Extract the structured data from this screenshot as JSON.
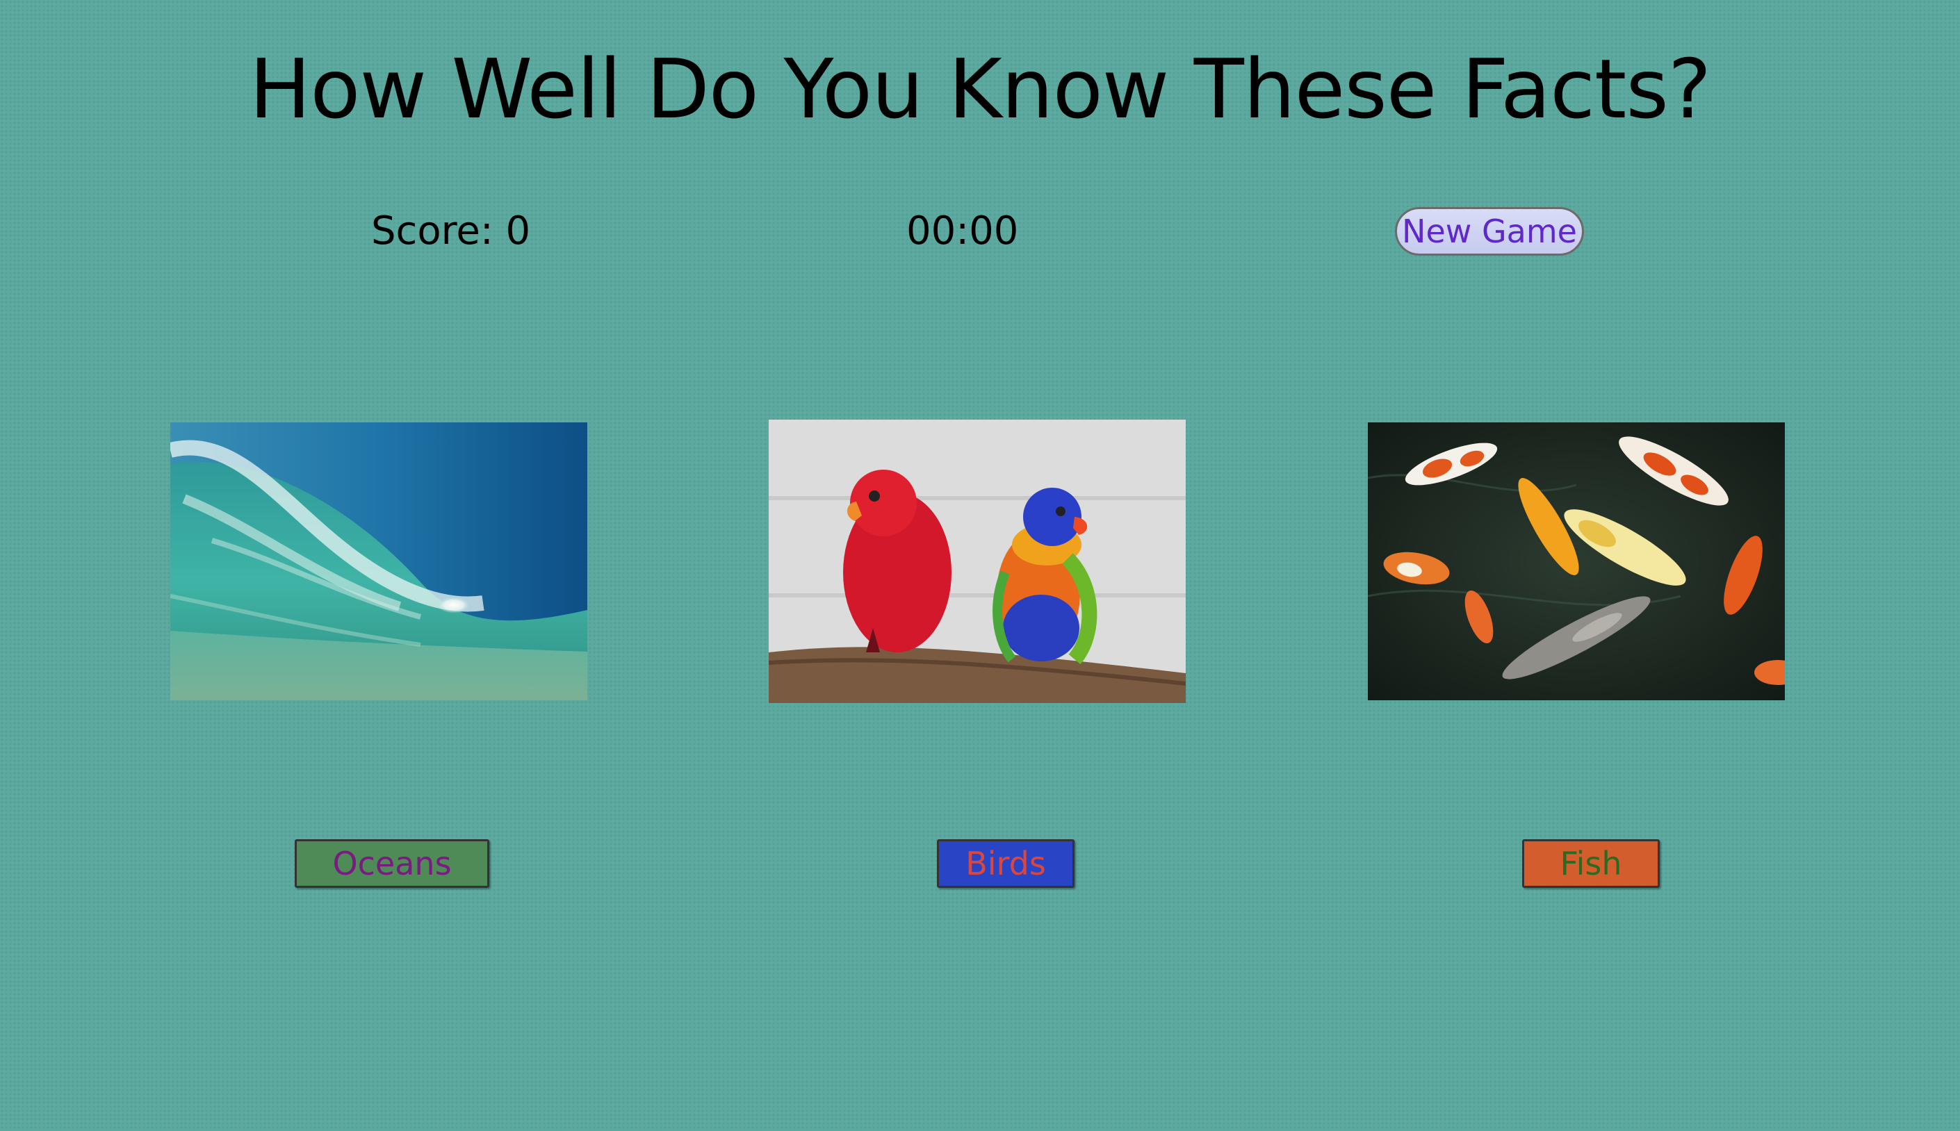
{
  "title": "How Well Do You Know These Facts?",
  "score_text": "Score: 0",
  "timer_text": "00:00",
  "new_game_label": "New Game",
  "categories": [
    {
      "label": "Oceans",
      "image": "ocean-wave-photo",
      "button_color": "#4e8b57",
      "text_color": "#7a1a82"
    },
    {
      "label": "Birds",
      "image": "parrots-photo",
      "button_color": "#2a44c6",
      "text_color": "#d8483e"
    },
    {
      "label": "Fish",
      "image": "koi-fish-photo",
      "button_color": "#d45d2e",
      "text_color": "#2b6a22"
    }
  ],
  "colors": {
    "background": "#5aa89e",
    "new_game_bg": "#c6cbef",
    "new_game_text": "#6028c8"
  }
}
